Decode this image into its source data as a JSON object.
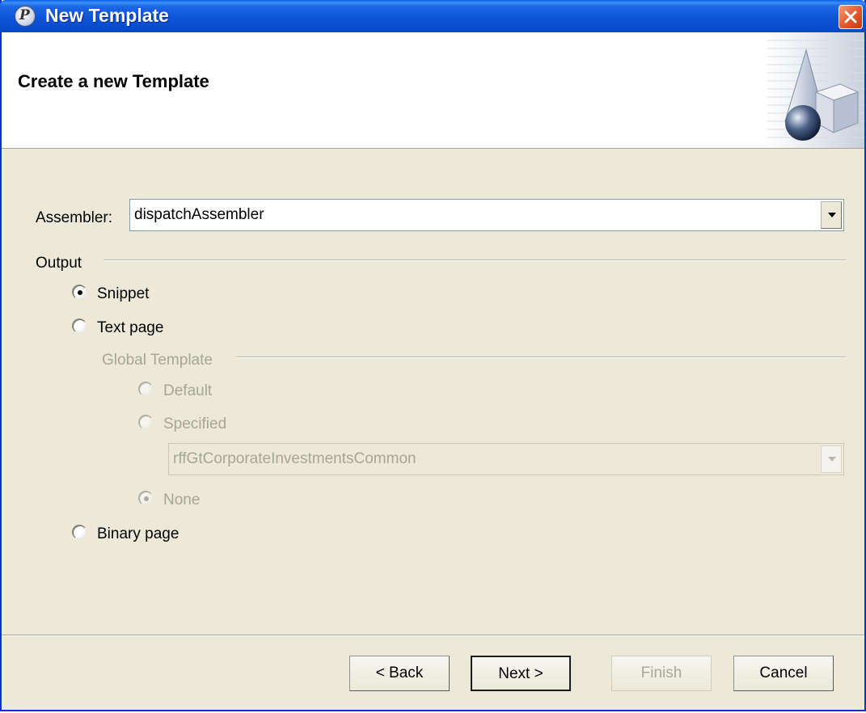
{
  "window": {
    "title": "New Template"
  },
  "header": {
    "title": "Create a new Template"
  },
  "assembler": {
    "label": "Assembler:",
    "value": "dispatchAssembler"
  },
  "output": {
    "label": "Output",
    "options": {
      "snippet": "Snippet",
      "text_page": "Text page",
      "binary_page": "Binary page"
    },
    "selected": "Snippet"
  },
  "global_template": {
    "label": "Global Template",
    "options": {
      "default": "Default",
      "specified": "Specified",
      "none": "None"
    },
    "selected": "None",
    "specified_value": "rffGtCorporateInvestmentsCommon",
    "enabled": false
  },
  "buttons": {
    "back": "< Back",
    "next": "Next >",
    "finish": "Finish",
    "cancel": "Cancel"
  },
  "icons": {
    "app": "app-logo-icon",
    "close": "close-icon",
    "banner": "wizard-shapes-icon"
  },
  "colors": {
    "titlebar": "#0b53d7",
    "dialog_bg": "#ece9d8",
    "close": "#e2582a"
  }
}
